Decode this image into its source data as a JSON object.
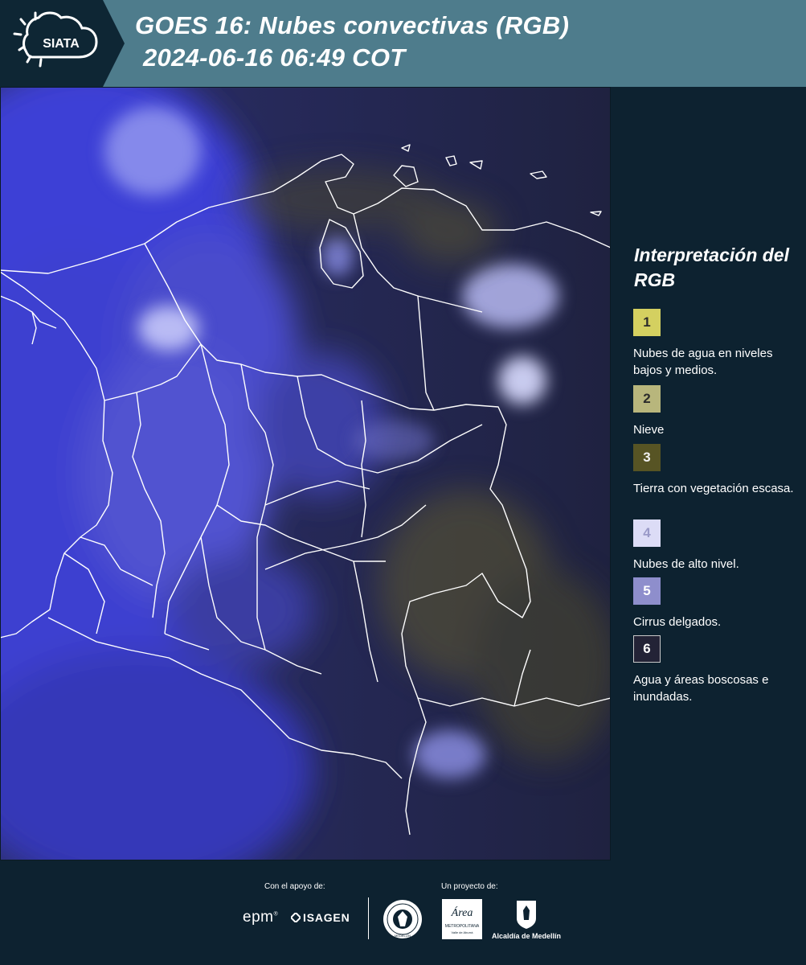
{
  "header": {
    "logo_text": "SIATA",
    "title_line1": "GOES 16: Nubes convectivas (RGB)",
    "title_line2": "2024-06-16 06:49 COT",
    "background_color": "#4e7c8c"
  },
  "legend": {
    "title": "Interpretación del RGB",
    "items": [
      {
        "number": "1",
        "color": "#d4d060",
        "text": "Nubes de agua en niveles bajos y medios."
      },
      {
        "number": "2",
        "color": "#b8b67c",
        "text": "Nieve"
      },
      {
        "number": "3",
        "color": "#575424",
        "text": "Tierra con vegetación escasa."
      },
      {
        "number": "4",
        "color": "#dcdcf6",
        "text": "Nubes de alto nivel."
      },
      {
        "number": "5",
        "color": "#8e8ecc",
        "text": "Cirrus delgados."
      },
      {
        "number": "6",
        "color": "#232336",
        "text": "Agua y áreas boscosas e inundadas."
      }
    ]
  },
  "footer": {
    "support_label": "Con el apoyo de:",
    "project_label": "Un proyecto de:",
    "sponsor1": "epm",
    "sponsor2": "ISAGEN",
    "partner_metro_name": "Área",
    "partner_metro_sub1": "METROPOLITANA",
    "partner_metro_sub2": "Valle de Aburrá",
    "partner_alcaldia": "Alcaldía de Medellín",
    "seal_text": "MEDELLÍN"
  },
  "map": {
    "colors": {
      "ocean_cloud_blue": "#3d3fd8",
      "high_cloud": "#c8caf4",
      "land_dark": "#23264a",
      "vegetation_yellow": "#6e6a36",
      "boundaries": "#ffffff"
    }
  }
}
